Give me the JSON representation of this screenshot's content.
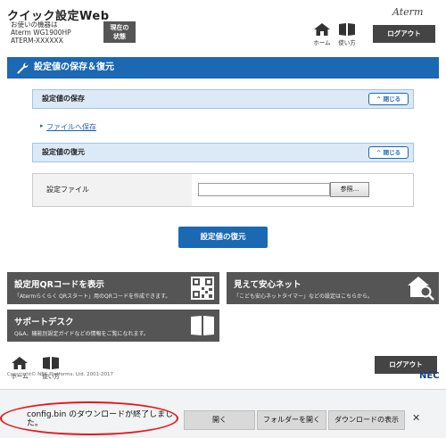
{
  "header": {
    "app_title": "クイック設定Web",
    "device_line1": "お使いの機器は",
    "device_line2": "Aterm WG1900HP",
    "device_line3": "ATERM-XXXXXX",
    "status_button_line1": "現在の",
    "status_button_line2": "状態",
    "brand": "Aterm",
    "home_label": "ホーム",
    "help_label": "使い方",
    "logout_label": "ログアウト"
  },
  "panel": {
    "title": "設定値の保存＆復元"
  },
  "save_section": {
    "title": "設定値の保存",
    "close_label": "閉じる",
    "link_label": "ファイルへ保存"
  },
  "restore_section": {
    "title": "設定値の復元",
    "close_label": "閉じる",
    "file_label": "設定ファイル",
    "file_value": "",
    "browse_label": "参照...",
    "restore_button": "設定値の復元"
  },
  "tiles": {
    "qr_title": "設定用QRコードを表示",
    "qr_desc": "「Atermらくらく QRスタート」用のQRコードを作成できます。",
    "anshin_title": "見えて安心ネット",
    "anshin_desc": "「こども安心ネットタイマー」などの設定はこちらから。",
    "support_title": "サポートデスク",
    "support_desc": "Q&A、機能別設定ガイドなどの情報をご覧になれます。"
  },
  "footer": {
    "home_label": "ホーム",
    "help_label": "使い方",
    "logout_label": "ログアウト",
    "copyright": "Copyright© NEC Platforms, Ltd. 2001-2017",
    "nec": "NEC"
  },
  "download_bar": {
    "message": "config.bin のダウンロードが終了しました。",
    "open_label": "開く",
    "open_folder_label": "フォルダーを開く",
    "show_downloads_label": "ダウンロードの表示"
  },
  "colors": {
    "accent": "#1b68b3",
    "tile": "#555555",
    "annotation": "#e8141a"
  }
}
